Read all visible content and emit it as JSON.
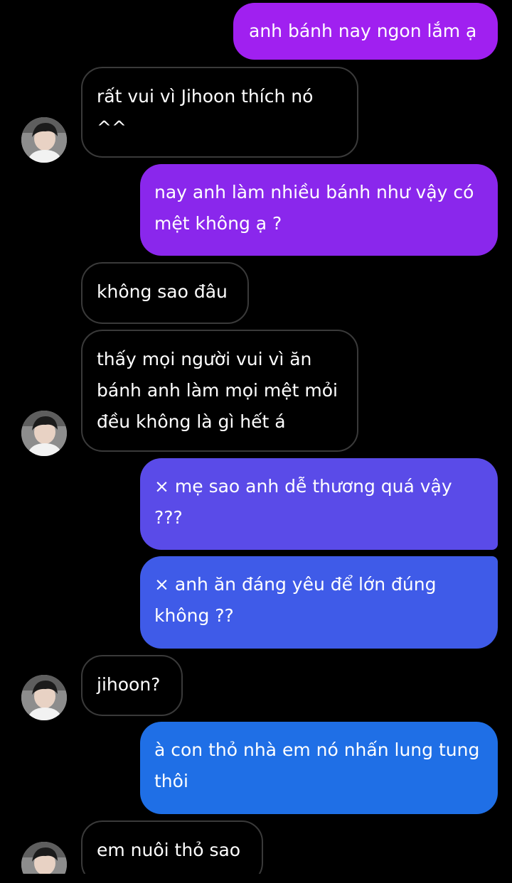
{
  "messages": [
    {
      "id": "m1",
      "direction": "outgoing",
      "text": "anh bánh nay ngon lắm ạ"
    },
    {
      "id": "m2",
      "direction": "incoming",
      "text": "rất vui vì Jihoon thích nó ^^"
    },
    {
      "id": "m3",
      "direction": "outgoing",
      "text": "nay anh làm nhiều bánh như vậy có mệt không ạ ?"
    },
    {
      "id": "m4",
      "direction": "incoming",
      "text": "không sao đâu"
    },
    {
      "id": "m5",
      "direction": "incoming",
      "text": "thấy mọi người vui vì ăn bánh anh làm mọi mệt mỏi đều không là gì hết á"
    },
    {
      "id": "m6",
      "direction": "outgoing",
      "text": "× mẹ sao anh dễ thương quá vậy ???"
    },
    {
      "id": "m7",
      "direction": "outgoing",
      "text": "× anh ăn đáng yêu để lớn đúng không ??"
    },
    {
      "id": "m8",
      "direction": "incoming",
      "text": "jihoon?"
    },
    {
      "id": "m9",
      "direction": "outgoing",
      "text": "à con thỏ nhà em nó nhấn lung tung thôi"
    },
    {
      "id": "m10",
      "direction": "incoming",
      "text": "em nuôi thỏ sao"
    }
  ],
  "colors": {
    "background": "#000000",
    "incoming_border": "#3a3a3a",
    "outgoing_gradient": [
      "#a020f0",
      "#8a2be2",
      "#5a4be8",
      "#3f5be8",
      "#1f6fe6"
    ],
    "text": "#ffffff"
  },
  "icons": {
    "avatar": "contact-avatar-photo"
  }
}
